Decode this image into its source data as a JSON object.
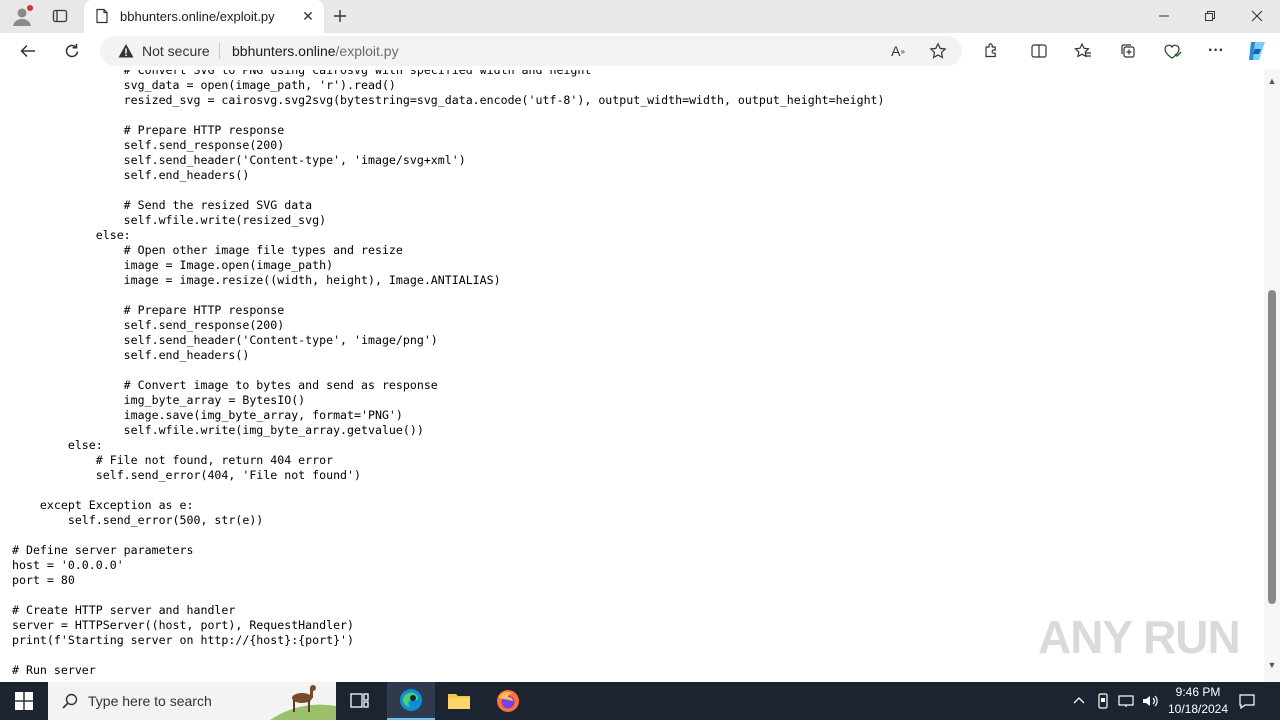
{
  "browser": {
    "tab_title": "bbhunters.online/exploit.py",
    "security_label": "Not secure",
    "url_host": "bbhunters.online",
    "url_path": "/exploit.py"
  },
  "code_lines": [
    "                # Convert SVG to PNG using cairosvg with specified width and height",
    "                svg_data = open(image_path, 'r').read()",
    "                resized_svg = cairosvg.svg2svg(bytestring=svg_data.encode('utf-8'), output_width=width, output_height=height)",
    "",
    "                # Prepare HTTP response",
    "                self.send_response(200)",
    "                self.send_header('Content-type', 'image/svg+xml')",
    "                self.end_headers()",
    "",
    "                # Send the resized SVG data",
    "                self.wfile.write(resized_svg)",
    "            else:",
    "                # Open other image file types and resize",
    "                image = Image.open(image_path)",
    "                image = image.resize((width, height), Image.ANTIALIAS)",
    "",
    "                # Prepare HTTP response",
    "                self.send_response(200)",
    "                self.send_header('Content-type', 'image/png')",
    "                self.end_headers()",
    "",
    "                # Convert image to bytes and send as response",
    "                img_byte_array = BytesIO()",
    "                image.save(img_byte_array, format='PNG')",
    "                self.wfile.write(img_byte_array.getvalue())",
    "        else:",
    "            # File not found, return 404 error",
    "            self.send_error(404, 'File not found')",
    "",
    "    except Exception as e:",
    "        self.send_error(500, str(e))",
    "",
    "# Define server parameters",
    "host = '0.0.0.0'",
    "port = 80",
    "",
    "# Create HTTP server and handler",
    "server = HTTPServer((host, port), RequestHandler)",
    "print(f'Starting server on http://{host}:{port}')",
    "",
    "# Run server"
  ],
  "watermark": "ANY RUN",
  "taskbar": {
    "search_placeholder": "Type here to search",
    "time": "9:46 PM",
    "date": "10/18/2024"
  },
  "colors": {
    "accent": "#0078d4",
    "taskbar_bg": "#1c2432",
    "copilot": "#2b88d8"
  }
}
